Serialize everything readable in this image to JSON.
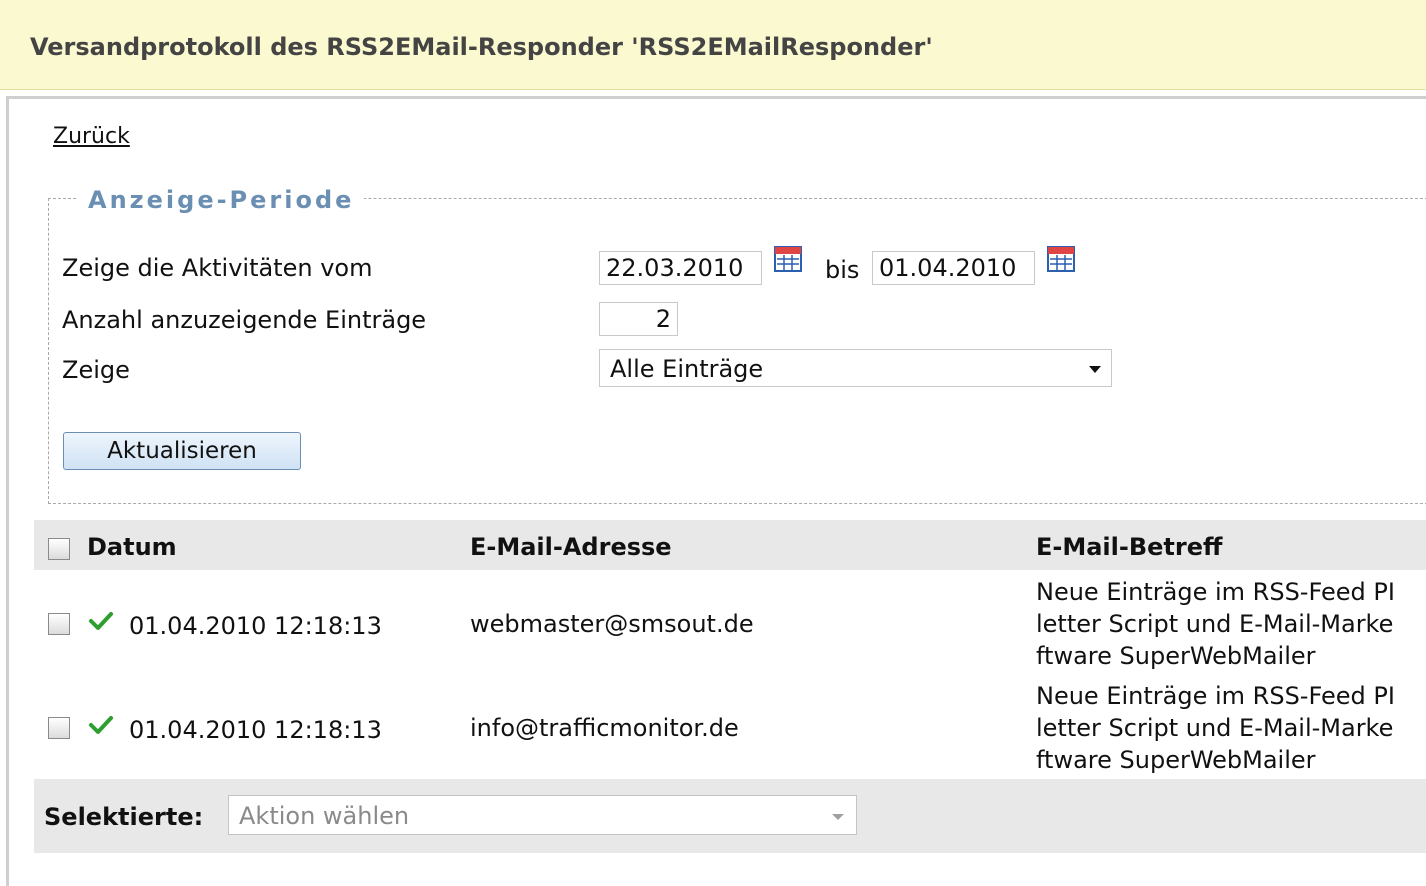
{
  "header": {
    "title": "Versandprotokoll des RSS2EMail-Responder 'RSS2EMailResponder'"
  },
  "nav": {
    "back_link": "Zurück"
  },
  "period": {
    "legend": "Anzeige-Periode",
    "from_label": "Zeige die Aktivitäten vom",
    "from_value": "22.03.2010",
    "to_label": "bis",
    "to_value": "01.04.2010",
    "count_label": "Anzahl anzuzeigende Einträge",
    "count_value": "2",
    "show_label": "Zeige",
    "show_selected": "Alle Einträge",
    "refresh_button": "Aktualisieren"
  },
  "table": {
    "columns": [
      "Datum",
      "E-Mail-Adresse",
      "E-Mail-Betreff"
    ],
    "rows": [
      {
        "status_icon": "check-icon",
        "date": "01.04.2010 12:18:13",
        "email": "webmaster@smsout.de",
        "subject": "Neue Einträge im RSS-Feed PI\nletter Script und E-Mail-Marke\nftware SuperWebMailer"
      },
      {
        "status_icon": "check-icon",
        "date": "01.04.2010 12:18:13",
        "email": "info@trafficmonitor.de",
        "subject": "Neue Einträge im RSS-Feed PI\nletter Script und E-Mail-Marke\nftware SuperWebMailer"
      }
    ]
  },
  "footer": {
    "selected_label": "Selektierte:",
    "action_placeholder": "Aktion wählen"
  },
  "colors": {
    "header_bg": "#fbf9cf",
    "legend_color": "#6b8fb3",
    "check_green": "#2e9e2e",
    "table_head_bg": "#e8e8e8"
  }
}
